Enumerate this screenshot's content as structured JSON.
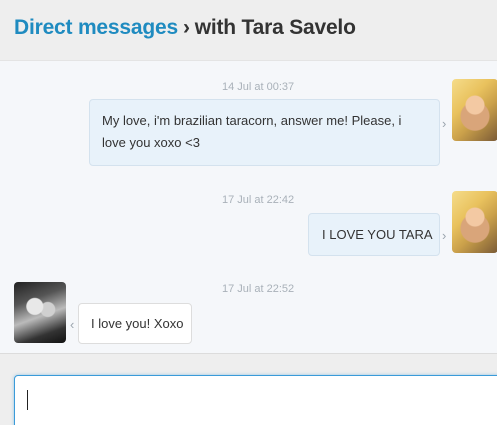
{
  "header": {
    "breadcrumb_link": "Direct messages",
    "separator": "›",
    "current": "with Tara Savelo"
  },
  "messages": [
    {
      "timestamp": "14 Jul at 00:37",
      "text": "My love, i'm brazilian taracorn, answer me! Please, i love you xoxo <3",
      "direction": "sent"
    },
    {
      "timestamp": "17 Jul at 22:42",
      "text": "I LOVE YOU TARA",
      "direction": "sent"
    },
    {
      "timestamp": "17 Jul at 22:52",
      "text": "I love you! Xoxo",
      "direction": "received"
    }
  ],
  "icons": {
    "sent_arrow": "›",
    "received_arrow": "‹"
  },
  "compose": {
    "value": ""
  },
  "colors": {
    "link": "#1f8bc0",
    "sent_bubble": "#e8f2fa",
    "received_bubble": "#ffffff",
    "focus_border": "#3a9bd9"
  }
}
